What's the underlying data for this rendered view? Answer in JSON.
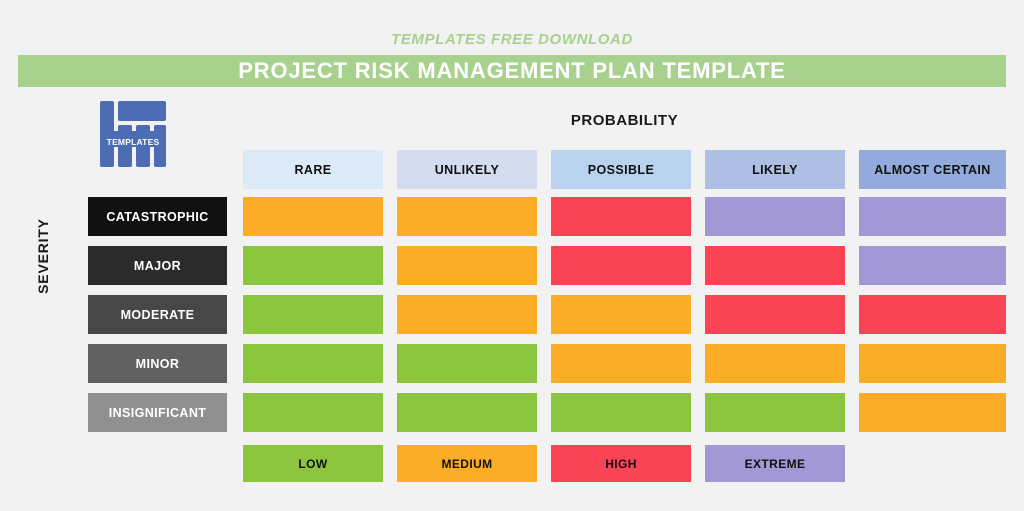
{
  "header": {
    "tagline": "TEMPLATES FREE DOWNLOAD",
    "title": "PROJECT RISK MANAGEMENT PLAN TEMPLATE",
    "bar_color": "#a9d18e",
    "tagline_color": "#a9d18e",
    "title_color": "#ffffff"
  },
  "logo": {
    "word": "TEMPLATES",
    "color": "#4c6cb3"
  },
  "axes": {
    "probability_label": "PROBABILITY",
    "severity_label": "SEVERITY"
  },
  "columns": [
    {
      "label": "RARE",
      "color": "#dce9f7"
    },
    {
      "label": "UNLIKELY",
      "color": "#d4dcf0"
    },
    {
      "label": "POSSIBLE",
      "color": "#b9d3ef"
    },
    {
      "label": "LIKELY",
      "color": "#aebfe4"
    },
    {
      "label": "ALMOST CERTAIN",
      "color": "#92aadc"
    }
  ],
  "rows": [
    {
      "label": "CATASTROPHIC",
      "color": "#111111",
      "text_color": "#ffffff"
    },
    {
      "label": "MAJOR",
      "color": "#2b2b2b",
      "text_color": "#ffffff"
    },
    {
      "label": "MODERATE",
      "color": "#474747",
      "text_color": "#ffffff"
    },
    {
      "label": "MINOR",
      "color": "#616161",
      "text_color": "#ffffff"
    },
    {
      "label": "INSIGNIFICANT",
      "color": "#909090",
      "text_color": "#ffffff"
    }
  ],
  "risk_levels": {
    "low": {
      "label": "LOW",
      "color": "#8cc63e"
    },
    "medium": {
      "label": "MEDIUM",
      "color": "#fbad28"
    },
    "high": {
      "label": "HIGH",
      "color": "#fb4356"
    },
    "extreme": {
      "label": "EXTREME",
      "color": "#a398d6"
    }
  },
  "legend": [
    {
      "label": "LOW",
      "color": "#8cc63e"
    },
    {
      "label": "MEDIUM",
      "color": "#fbad28"
    },
    {
      "label": "HIGH",
      "color": "#fb4356"
    },
    {
      "label": "EXTREME",
      "color": "#a398d6"
    }
  ],
  "matrix": [
    {
      "severity": "CATASTROPHIC",
      "cells": [
        "medium",
        "medium",
        "high",
        "extreme",
        "extreme"
      ]
    },
    {
      "severity": "MAJOR",
      "cells": [
        "low",
        "medium",
        "high",
        "high",
        "extreme"
      ]
    },
    {
      "severity": "MODERATE",
      "cells": [
        "low",
        "medium",
        "medium",
        "high",
        "high"
      ]
    },
    {
      "severity": "MINOR",
      "cells": [
        "low",
        "low",
        "medium",
        "medium",
        "medium"
      ]
    },
    {
      "severity": "INSIGNIFICANT",
      "cells": [
        "low",
        "low",
        "low",
        "low",
        "medium"
      ]
    }
  ],
  "background_color": "#f2f2f2"
}
